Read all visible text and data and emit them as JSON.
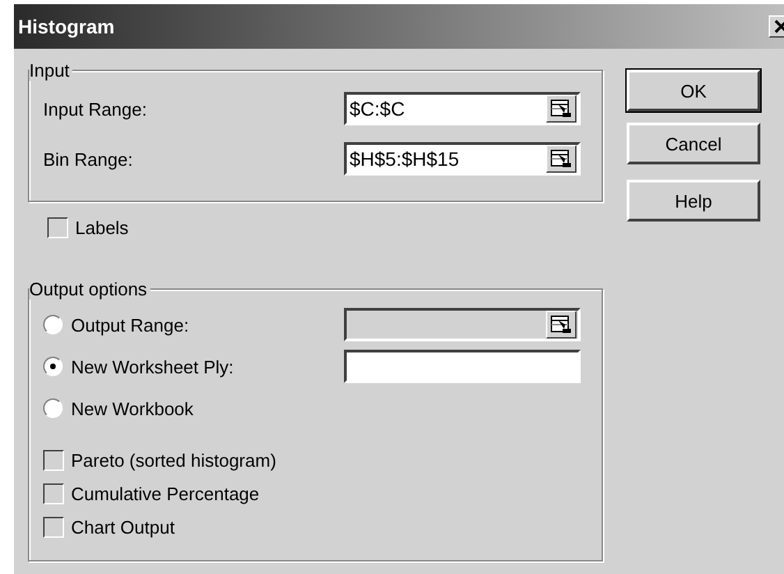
{
  "window": {
    "title": "Histogram"
  },
  "input_group": {
    "title": "Input",
    "fields": [
      {
        "label": "Input Range:",
        "value": "$C:$C",
        "disabled": false,
        "picker": true
      },
      {
        "label": "Bin Range:",
        "value": "$H$5:$H$15",
        "disabled": false,
        "picker": true
      }
    ]
  },
  "labels_checkbox": {
    "label": "Labels",
    "checked": false
  },
  "output_group": {
    "title": "Output options",
    "options": [
      {
        "label": "Output Range:",
        "selected": false,
        "field": {
          "disabled": true,
          "picker": true
        }
      },
      {
        "label": "New Worksheet Ply:",
        "selected": true,
        "field": {
          "disabled": false,
          "picker": false
        }
      },
      {
        "label": "New Workbook",
        "selected": false
      }
    ],
    "checkboxes": [
      {
        "label": "Pareto (sorted histogram)",
        "checked": false
      },
      {
        "label": "Cumulative Percentage",
        "checked": false
      },
      {
        "label": "Chart Output",
        "checked": false
      }
    ]
  },
  "buttons": [
    {
      "label": "OK",
      "default": true
    },
    {
      "label": "Cancel",
      "default": false
    },
    {
      "label": "Help",
      "default": false
    }
  ]
}
